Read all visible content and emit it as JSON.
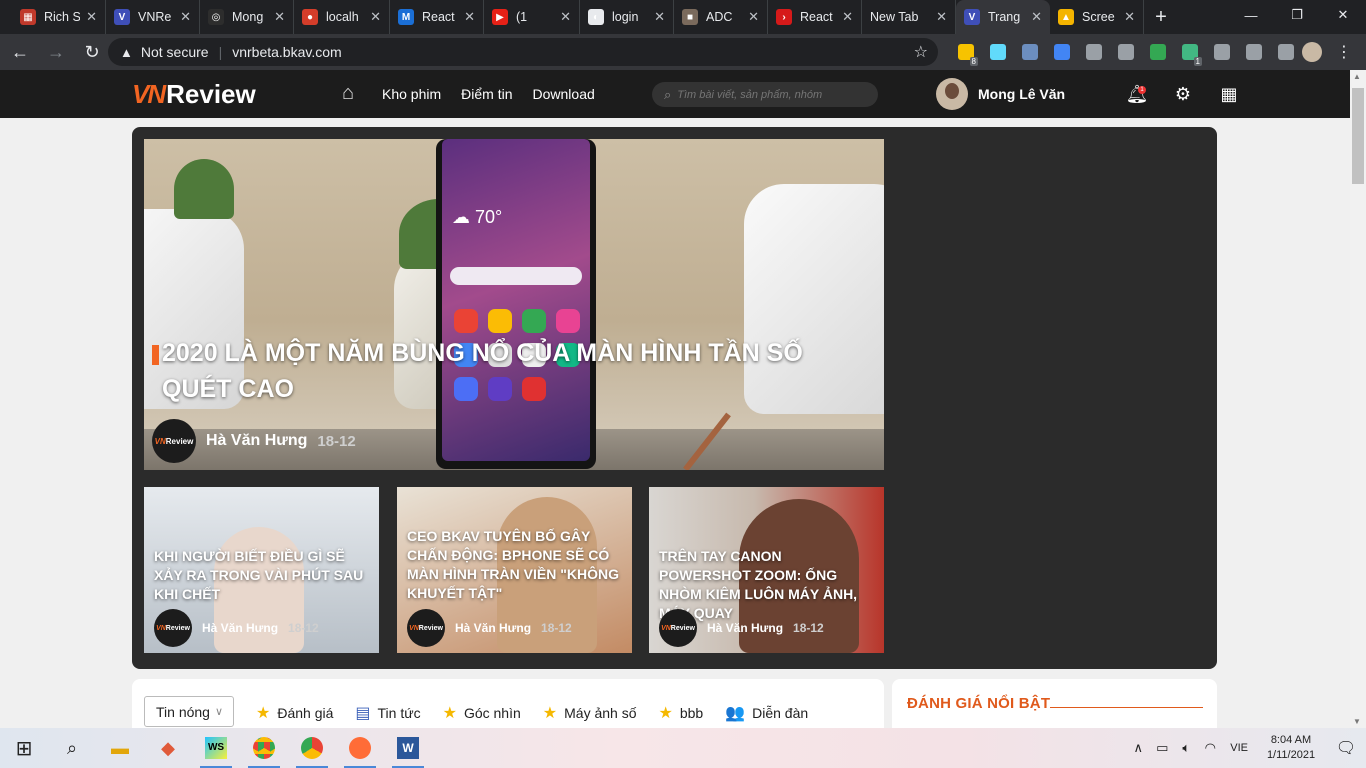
{
  "browser": {
    "tabs": [
      {
        "title": "Rich S",
        "color": "#c0392b",
        "glyph": "▦"
      },
      {
        "title": "VNRe",
        "color": "#3f4fb8",
        "glyph": "V"
      },
      {
        "title": "Mong",
        "color": "#2d2d2d",
        "glyph": "◎"
      },
      {
        "title": "localh",
        "color": "#d43d2a",
        "glyph": "●"
      },
      {
        "title": "React",
        "color": "#1b6fd6",
        "glyph": "M"
      },
      {
        "title": "(1",
        "color": "#e62117",
        "glyph": "▶"
      },
      {
        "title": "login",
        "color": "#e8eaed",
        "glyph": "◐"
      },
      {
        "title": "ADC",
        "color": "#7a6a5c",
        "glyph": "■"
      },
      {
        "title": "React",
        "color": "#d61a1a",
        "glyph": "›"
      },
      {
        "title": "New Tab",
        "color": "",
        "glyph": ""
      },
      {
        "title": "Trang",
        "color": "#3f4fb8",
        "glyph": "V"
      },
      {
        "title": "Scree",
        "color": "#f4b400",
        "glyph": "▲"
      }
    ],
    "security": "Not secure",
    "url": "vnrbeta.bkav.com",
    "extensions": [
      {
        "name": "sticky-notes-ext",
        "color": "#f7c300",
        "badge": "8"
      },
      {
        "name": "react-devtools-ext",
        "color": "#61dafb",
        "badge": ""
      },
      {
        "name": "tools-ext",
        "color": "#6c8ebf",
        "badge": ""
      },
      {
        "name": "translate-ext",
        "color": "#4285f4",
        "badge": ""
      },
      {
        "name": "phone-ext",
        "color": "#9aa0a6",
        "badge": ""
      },
      {
        "name": "record-ext",
        "color": "#9aa0a6",
        "badge": ""
      },
      {
        "name": "drive-ext",
        "color": "#34a853",
        "badge": ""
      },
      {
        "name": "vue-devtools-ext",
        "color": "#42b883",
        "badge": "1"
      },
      {
        "name": "shield-ext",
        "color": "#9aa0a6",
        "badge": ""
      },
      {
        "name": "puzzle-ext",
        "color": "#9aa0a6",
        "badge": ""
      },
      {
        "name": "reading-list-ext",
        "color": "#9aa0a6",
        "badge": ""
      }
    ]
  },
  "site": {
    "logo_vn": "VN",
    "logo_review": "Review",
    "nav": [
      "Kho phim",
      "Điểm tin",
      "Download"
    ],
    "search_placeholder": "Tìm bài viết, sản phẩm, nhóm",
    "user_name": "Mong Lê Văn",
    "notification_count": "1"
  },
  "hero": {
    "main": {
      "title": "2020 LÀ MỘT NĂM BÙNG NỔ CỦA MÀN HÌNH TẦN SỐ QUÉT CAO",
      "author": "Hà Văn Hưng",
      "date": "18-12",
      "phone_temp": "70°"
    },
    "cards": [
      {
        "title": "KHI NGƯỜI BIẾT ĐIỀU GÌ SẼ XẢY RA TRONG VÀI PHÚT SAU KHI CHẾT",
        "author": "Hà Văn Hưng",
        "date": "18-12",
        "bg": "#d8dde4"
      },
      {
        "title": "CEO BKAV TUYÊN BỐ GÂY CHẤN ĐỘNG: BPHONE SẼ CÓ MÀN HÌNH TRÀN VIỀN \"KHÔNG KHUYẾT TẬT\"",
        "author": "Hà Văn Hưng",
        "date": "18-12",
        "bg": "#c9a07a"
      },
      {
        "title": "TRÊN TAY CANON POWERSHOT ZOOM: ỐNG NHÒM KIÊM LUÔN MÁY ẢNH, MÁY QUAY",
        "author": "Hà Văn Hưng",
        "date": "18-12",
        "bg": "#b33c2e"
      }
    ],
    "logo_text_vn": "VN",
    "logo_text_review": "Review"
  },
  "categories": {
    "selected": "Tin nóng",
    "items": [
      {
        "label": "Đánh giá",
        "icon": "★",
        "color": "#f5b800"
      },
      {
        "label": "Tin tức",
        "icon": "▤",
        "color": "#3a5fb8"
      },
      {
        "label": "Góc nhìn",
        "icon": "★",
        "color": "#f5b800"
      },
      {
        "label": "Máy ảnh số",
        "icon": "★",
        "color": "#f5b800"
      },
      {
        "label": "bbb",
        "icon": "★",
        "color": "#f5b800"
      },
      {
        "label": "Diễn đàn",
        "icon": "👥",
        "color": "#1fb39a"
      }
    ]
  },
  "featured": {
    "title": "ĐÁNH GIÁ NỔI BẬT"
  },
  "taskbar": {
    "language": "VIE",
    "time": "8:04 AM",
    "date": "1/11/2021"
  }
}
